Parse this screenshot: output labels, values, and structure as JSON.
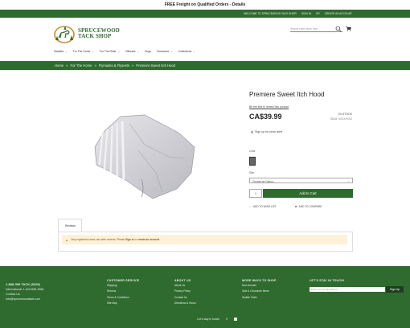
{
  "topbar": {
    "text": "FREE Freight on Qualified Orders - Details"
  },
  "account_bar": {
    "links": [
      "WELCOME TO SPRUCEWOOD TACK SHOP!",
      "SIGN IN",
      "OR",
      "CREATE AN ACCOUNT"
    ]
  },
  "brand": {
    "line1": "SPRUCEWOOD",
    "line2": "TACK SHOP",
    "color": "#2f6b2f"
  },
  "search": {
    "placeholder": "Search entire store here..."
  },
  "nav": {
    "items": [
      {
        "label": "Saddles"
      },
      {
        "label": "For The Horse"
      },
      {
        "label": "For The Rider"
      },
      {
        "label": "Giftware"
      },
      {
        "label": "Dogs"
      },
      {
        "label": "Clearance"
      },
      {
        "label": "Collections"
      }
    ],
    "items_with_dropdown": [
      true,
      true,
      true,
      true,
      false,
      true,
      true
    ]
  },
  "breadcrumb": {
    "items": [
      "Home",
      "For The Horse",
      "Flymasks & Flysests",
      "Premiere Sweet Itch Hood"
    ],
    "separator": "»"
  },
  "product": {
    "title": "Premiere Sweet Itch Hood",
    "review_link": "Be the first to review this product",
    "price": "CA$39.99",
    "stock": "IN STOCK",
    "sku_label": "SKU#:",
    "sku_value": "XXXXXXXX",
    "price_alert": "Sign up for price alert",
    "color_label": "Color",
    "size_label": "Size",
    "size_select_value": "Choose an Option...",
    "qty": "1",
    "add_to_cart": "Add to Cart",
    "wishlist": "ADD TO WISH LIST",
    "compare": "ADD TO COMPARE",
    "swatch_color": "#666666"
  },
  "reviews": {
    "tab_label": "Reviews",
    "notice_text": "Only registered users can write reviews. Please ",
    "notice_link1": "Sign in",
    "notice_mid": " or ",
    "notice_link2": "create an account"
  },
  "footer": {
    "phone": "1-888-399 TACK (8225)",
    "international": "International: 1-519-656-3366",
    "contact_label": "Contact Us",
    "email": "info@sprucewoodtack.com",
    "customer_service": {
      "heading": "CUSTOMER SERVICE",
      "links": [
        "Shipping",
        "Returns",
        "Terms & Conditions",
        "Site Map"
      ]
    },
    "about": {
      "heading": "ABOUT US",
      "links": [
        "About Us",
        "Privacy Policy",
        "Contact Us",
        "Directions & Hours"
      ]
    },
    "more_ways": {
      "heading": "MORE WAYS TO SHOP",
      "links": [
        "New Arrivals",
        "Sale & Clearance Items",
        "Saddle Trials"
      ]
    },
    "newsletter": {
      "heading": "LET'S STAY IN TOUCH!",
      "placeholder": "Enter your email address",
      "button": "Sign Up"
    },
    "bottom_text": "Let's stay in touch!"
  },
  "colors": {
    "primary_green": "#2f6b2f",
    "notice_bg": "#fdf1d7"
  }
}
